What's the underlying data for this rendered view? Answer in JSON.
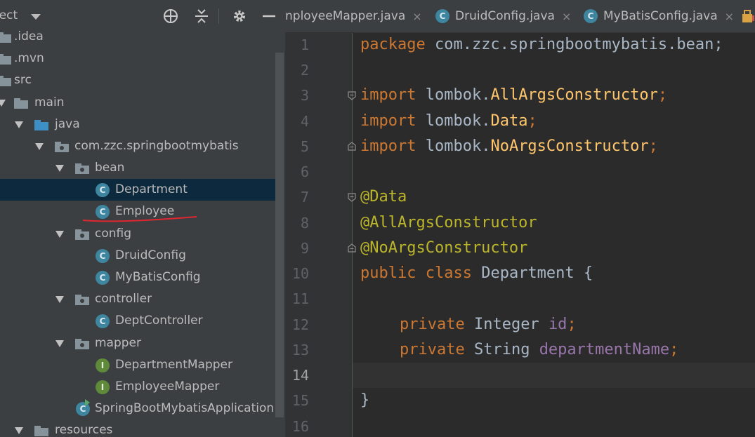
{
  "project_panel": {
    "title": "ject",
    "tree": [
      {
        "label": ".idea",
        "type": "folder"
      },
      {
        "label": ".mvn",
        "type": "folder"
      },
      {
        "label": "src",
        "type": "folder"
      },
      {
        "label": "main",
        "type": "folder",
        "expanded": true
      },
      {
        "label": "java",
        "type": "source-folder",
        "expanded": true
      },
      {
        "label": "com.zzc.springbootmybatis",
        "type": "package",
        "expanded": true
      },
      {
        "label": "bean",
        "type": "package",
        "expanded": true
      },
      {
        "label": "Department",
        "type": "class",
        "selected": true
      },
      {
        "label": "Employee",
        "type": "class",
        "underlined": true
      },
      {
        "label": "config",
        "type": "package",
        "expanded": true
      },
      {
        "label": "DruidConfig",
        "type": "class"
      },
      {
        "label": "MyBatisConfig",
        "type": "class"
      },
      {
        "label": "controller",
        "type": "package",
        "expanded": true
      },
      {
        "label": "DeptController",
        "type": "class"
      },
      {
        "label": "mapper",
        "type": "package",
        "expanded": true
      },
      {
        "label": "DepartmentMapper",
        "type": "interface"
      },
      {
        "label": "EmployeeMapper",
        "type": "interface"
      },
      {
        "label": "SpringBootMybatisApplication",
        "type": "spring-app"
      },
      {
        "label": "resources",
        "type": "folder",
        "expanded": true
      }
    ],
    "icons": {
      "locate": "crosshair-icon",
      "collapse": "collapse-all-icon",
      "settings": "gear-icon",
      "hide": "minimize-icon"
    }
  },
  "editor_tabs": [
    {
      "label": "nployeeMapper.java",
      "close": "×"
    },
    {
      "label": "DruidConfig.java",
      "icon": "C",
      "close": "×"
    },
    {
      "label": "MyBatisConfig.java",
      "icon": "C",
      "close": "×"
    }
  ],
  "editor": {
    "line_numbers": [
      "1",
      "2",
      "3",
      "4",
      "5",
      "6",
      "7",
      "8",
      "9",
      "10",
      "11",
      "12",
      "13",
      "14",
      "15",
      "16"
    ],
    "current_line": "14",
    "lines": {
      "l1": {
        "kw": "package",
        "rest": " com.zzc.springbootmybatis.bean;"
      },
      "l3": {
        "kw": "import",
        "pkg": " lombok.",
        "cls": "AllArgsConstructor",
        "end": ";"
      },
      "l4": {
        "kw": "import",
        "pkg": " lombok.",
        "cls": "Data",
        "end": ";"
      },
      "l5": {
        "kw": "import",
        "pkg": " lombok.",
        "cls": "NoArgsConstructor",
        "end": ";"
      },
      "l7": {
        "ann": "@Data"
      },
      "l8": {
        "ann": "@AllArgsConstructor"
      },
      "l9": {
        "ann": "@NoArgsConstructor"
      },
      "l10": {
        "kw1": "public",
        "kw2": "class",
        "name": " Department {"
      },
      "l12": {
        "kw": "private",
        "type": " Integer ",
        "field": "id",
        "end": ";"
      },
      "l13": {
        "kw": "private",
        "type": " String ",
        "field": "departmentName",
        "end": ";"
      },
      "l15": {
        "text": "}"
      }
    }
  },
  "colors": {
    "keyword": "#cc7832",
    "annotation": "#bbb529",
    "field": "#9876aa",
    "plain": "#a9b7c6",
    "selection": "#0d293e",
    "underline": "#e0262e"
  }
}
